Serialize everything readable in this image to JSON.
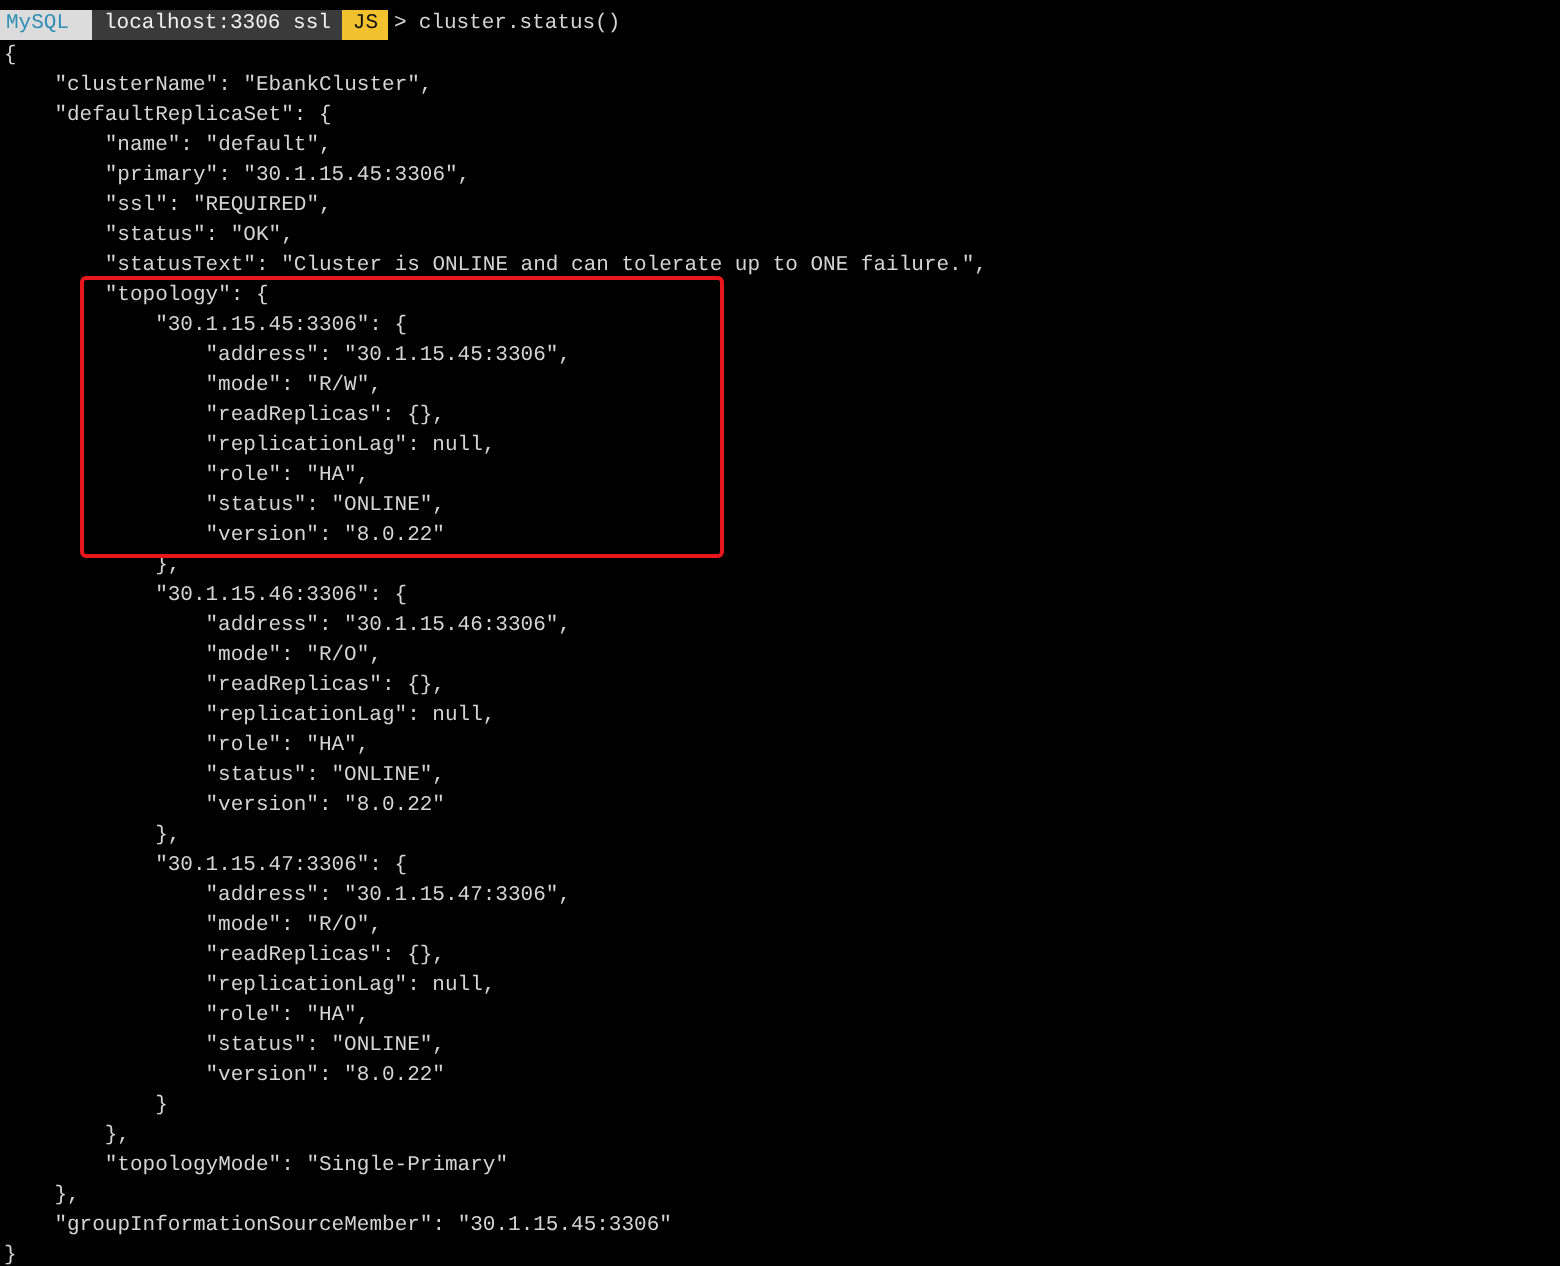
{
  "prompt": {
    "product": "MySQL",
    "connection": "localhost:3306 ssl",
    "mode": "JS",
    "symbol": ">",
    "command": "cluster.status()"
  },
  "output": [
    {
      "text": "{",
      "children": [
        {
          "text": "\"clusterName\": \"EbankCluster\","
        },
        {
          "text": "\"defaultReplicaSet\": {",
          "children": [
            {
              "text": "\"name\": \"default\","
            },
            {
              "text": "\"primary\": \"30.1.15.45:3306\","
            },
            {
              "text": "\"ssl\": \"REQUIRED\","
            },
            {
              "text": "\"status\": \"OK\","
            },
            {
              "text": "\"statusText\": \"Cluster is ONLINE and can tolerate up to ONE failure.\","
            },
            {
              "text": "\"topology\": {",
              "children": [
                {
                  "text": "\"30.1.15.45:3306\": {",
                  "children": [
                    {
                      "text": "\"address\": \"30.1.15.45:3306\","
                    },
                    {
                      "text": "\"mode\": \"R/W\","
                    },
                    {
                      "text": "\"readReplicas\": {},"
                    },
                    {
                      "text": "\"replicationLag\": null,"
                    },
                    {
                      "text": "\"role\": \"HA\","
                    },
                    {
                      "text": "\"status\": \"ONLINE\","
                    },
                    {
                      "text": "\"version\": \"8.0.22\""
                    }
                  ]
                },
                {
                  "text": "},"
                },
                {
                  "text": "\"30.1.15.46:3306\": {",
                  "children": [
                    {
                      "text": "\"address\": \"30.1.15.46:3306\","
                    },
                    {
                      "text": "\"mode\": \"R/O\","
                    },
                    {
                      "text": "\"readReplicas\": {},"
                    },
                    {
                      "text": "\"replicationLag\": null,"
                    },
                    {
                      "text": "\"role\": \"HA\","
                    },
                    {
                      "text": "\"status\": \"ONLINE\","
                    },
                    {
                      "text": "\"version\": \"8.0.22\""
                    }
                  ]
                },
                {
                  "text": "},"
                },
                {
                  "text": "\"30.1.15.47:3306\": {",
                  "children": [
                    {
                      "text": "\"address\": \"30.1.15.47:3306\","
                    },
                    {
                      "text": "\"mode\": \"R/O\","
                    },
                    {
                      "text": "\"readReplicas\": {},"
                    },
                    {
                      "text": "\"replicationLag\": null,"
                    },
                    {
                      "text": "\"role\": \"HA\","
                    },
                    {
                      "text": "\"status\": \"ONLINE\","
                    },
                    {
                      "text": "\"version\": \"8.0.22\""
                    }
                  ]
                },
                {
                  "text": "}"
                }
              ]
            },
            {
              "text": "},"
            },
            {
              "text": "\"topologyMode\": \"Single-Primary\""
            }
          ]
        },
        {
          "text": "},"
        },
        {
          "text": "\"groupInformationSourceMember\": \"30.1.15.45:3306\""
        }
      ]
    },
    {
      "text": "}"
    }
  ],
  "annotation": {
    "kind": "rectangle"
  }
}
